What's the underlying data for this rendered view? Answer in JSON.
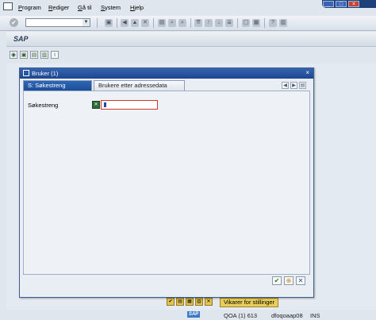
{
  "menu": [
    "Program",
    "Rediger",
    "Gå til",
    "System",
    "Hjelp"
  ],
  "window_controls": [
    "_",
    "□",
    "×"
  ],
  "toolbar": {
    "command_field_value": "",
    "icons": [
      "enter-icon",
      "save-icon",
      "back-icon",
      "exit-icon",
      "cancel-icon",
      "print-icon",
      "find-icon",
      "find-next-icon",
      "first-page-icon",
      "prev-page-icon",
      "next-page-icon",
      "last-page-icon",
      "new-session-icon",
      "shortcut-icon",
      "help-icon",
      "layout-icon"
    ]
  },
  "title_bar": {
    "title": "SAP"
  },
  "dialog": {
    "title": "Bruker (1)",
    "close": "×",
    "tabs": [
      "S: Søkestreng",
      "Brukere etter adressedata"
    ],
    "field_label": "Søkestreng",
    "field_value": "",
    "buttons": [
      "continue-check",
      "multiple-selection",
      "cancel"
    ]
  },
  "lower_toolbar": {
    "vikarer_label": "Vikarer for stillinger"
  },
  "status_bar": {
    "system": "QOA (1) 613",
    "server": "dfoqoaap08",
    "mode": "INS"
  }
}
